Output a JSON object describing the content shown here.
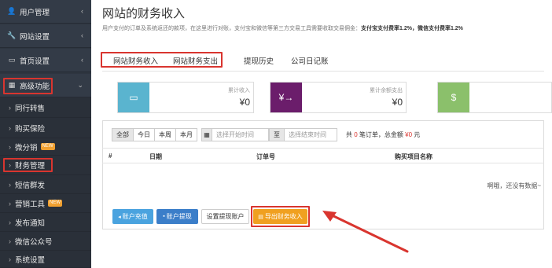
{
  "sidebar": {
    "items": [
      {
        "label": "用户管理",
        "icon": "user-icon"
      },
      {
        "label": "网站设置",
        "icon": "wrench-icon"
      },
      {
        "label": "首页设置",
        "icon": "monitor-icon"
      },
      {
        "label": "高级功能",
        "icon": "grid-icon"
      }
    ],
    "subitems": [
      {
        "label": "同行转售"
      },
      {
        "label": "购买保险"
      },
      {
        "label": "微分销",
        "badge": "NEW"
      },
      {
        "label": "财务管理"
      },
      {
        "label": "短信群发"
      },
      {
        "label": "营销工具",
        "badge": "NEW"
      },
      {
        "label": "发布通知"
      },
      {
        "label": "微信公众号"
      },
      {
        "label": "系统设置"
      }
    ]
  },
  "page": {
    "title": "网站的财务收入",
    "desc_prefix": "用户支付的订单及系统返还的款项，在这里进行对账，支付宝和微信等第三方交易工具需要收取交易佣金：",
    "desc_rate": "支付宝支付费率1.2%，微信支付费率1.2%"
  },
  "tabs": [
    "网站财务收入",
    "网站财务支出",
    "提现历史",
    "公司日记账"
  ],
  "cards": [
    {
      "label": "累计收入",
      "value": "¥0",
      "color": "#5ab4cf"
    },
    {
      "label": "累计余额支出",
      "value": "¥0",
      "color": "#6b1d6b"
    },
    {
      "label": "",
      "value": "",
      "color": "#8bc06b"
    }
  ],
  "filter": {
    "buttons": [
      "全部",
      "今日",
      "本周",
      "本月"
    ],
    "start_placeholder": "选择开始时间",
    "to_label": "至",
    "end_placeholder": "选择结束时间",
    "summary_a": "共",
    "count": "0",
    "summary_b": "笔订单，总金额",
    "amount": "¥0",
    "summary_c": "元"
  },
  "table": {
    "columns": [
      "#",
      "日期",
      "订单号",
      "购买项目名称"
    ],
    "empty_text": "啊哦，还没有数据~"
  },
  "actions": {
    "recharge": "账户充值",
    "withdraw": "账户提现",
    "set_account": "设置提现账户",
    "export": "导出财务收入"
  },
  "colors": {
    "sidebar_bg": "#2e3540",
    "highlight_red": "#d9352f",
    "accent_orange": "#f0a020",
    "button_blue": "#3b7ec9"
  }
}
